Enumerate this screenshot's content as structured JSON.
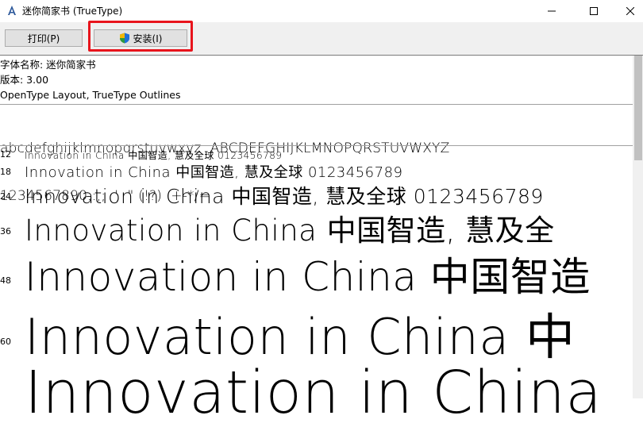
{
  "window": {
    "title": "迷你简家书 (TrueType)",
    "icon": "font-viewer-icon"
  },
  "toolbar": {
    "print_label": "打印(P)",
    "install_label": "安装(I)"
  },
  "info": {
    "font_name": "字体名称: 迷你简家书",
    "version": "版本: 3.00",
    "outline_type": "OpenType Layout, TrueType Outlines"
  },
  "charset": {
    "line1": "abcdefghijklmnopqrstuvwxyz  ABCDEFGHIJKLMNOPQRSTUVWXYZ",
    "line2": "1234567890.:,;  '  \" (!?)  +-*/="
  },
  "samples": [
    {
      "size": "12",
      "text": "Innovation in China 中国智造, 慧及全球 0123456789"
    },
    {
      "size": "18",
      "text": "Innovation in China 中国智造, 慧及全球 0123456789"
    },
    {
      "size": "24",
      "text": "Innovation in China 中国智造, 慧及全球 0123456789"
    },
    {
      "size": "36",
      "text": "Innovation in China 中国智造, 慧及全"
    },
    {
      "size": "48",
      "text": "Innovation in China 中国智造"
    },
    {
      "size": "60",
      "text": "Innovation in China 中"
    },
    {
      "size": "",
      "text": "Innovation in China"
    }
  ],
  "colors": {
    "highlight": "#e8141c",
    "toolbar_bg": "#f0f0f0"
  }
}
